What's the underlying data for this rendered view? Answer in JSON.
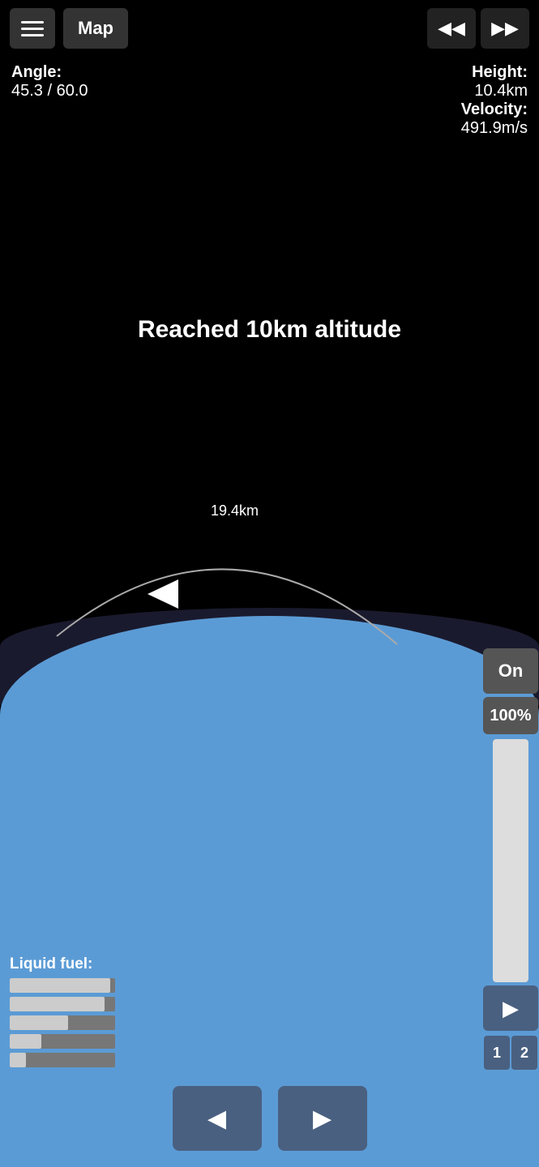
{
  "toolbar": {
    "menu_label": "menu",
    "map_label": "Map",
    "rewind_label": "◀◀",
    "fastforward_label": "▶▶"
  },
  "stats": {
    "angle_label": "Angle:",
    "angle_value": "45.3 / 60.0",
    "height_label": "Height:",
    "height_value": "10.4km",
    "velocity_label": "Velocity:",
    "velocity_value": "491.9m/s"
  },
  "achievement": {
    "text": "Reached 10km altitude"
  },
  "scene": {
    "distance": "19.4km"
  },
  "controls": {
    "on_label": "On",
    "throttle_pct": "100%",
    "throttle_fill_pct": 100,
    "play_label": "▶",
    "num1": "1",
    "num2": "2"
  },
  "fuel": {
    "label": "Liquid fuel:",
    "bars": [
      {
        "fill": 95
      },
      {
        "fill": 90
      },
      {
        "fill": 55
      },
      {
        "fill": 30
      },
      {
        "fill": 15
      }
    ]
  },
  "bottom": {
    "rewind_label": "◀",
    "play_label": "▶"
  }
}
